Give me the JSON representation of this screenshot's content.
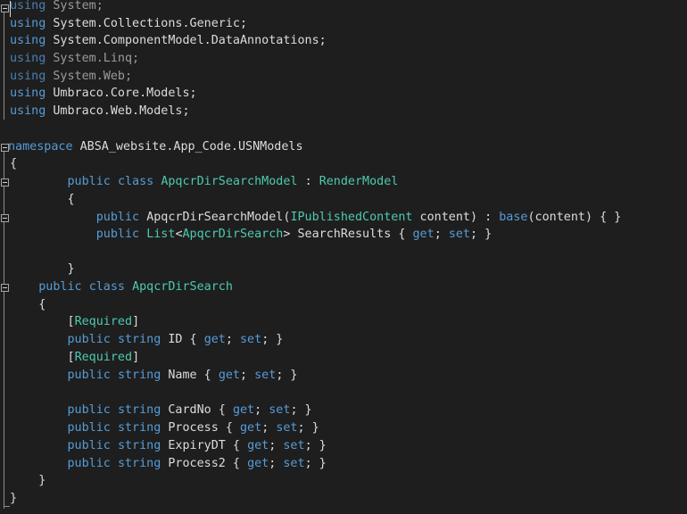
{
  "tokens": {
    "using": "using",
    "namespace": "namespace",
    "public": "public",
    "class": "class",
    "string": "string",
    "get": "get",
    "set": "set",
    "base": "base",
    "System": "System;",
    "Collections": "System.Collections.Generic;",
    "DataAnnotations": "System.ComponentModel.DataAnnotations;",
    "Linq": "System.Linq;",
    "Web": "System.Web;",
    "UmbracoCore": "Umbraco.Core.Models;",
    "UmbracoWeb": "Umbraco.Web.Models;",
    "nsName": "ABSA_website.App_Code.USNModels",
    "openBrace": "{",
    "closeBrace": "}",
    "colon": ":",
    "modelClass": "ApqcrDirSearchModel",
    "renderModel": "RenderModel",
    "ctorName": "ApqcrDirSearchModel(",
    "iPublished": "IPublishedContent",
    "ctorRest1": " content) : ",
    "ctorRest2": "(content) { }",
    "listType": "List",
    "lt": "<",
    "gt": ">",
    "searchType": "ApqcrDirSearch",
    "searchResults": " SearchResults { ",
    "accEnd": "; }",
    "semiSpace": "; ",
    "required": "Required",
    "lbr": "[",
    "rbr": "]",
    "idProp": " ID { ",
    "nameProp": " Name { ",
    "cardNoProp": " CardNo { ",
    "processProp": " Process { ",
    "expiryProp": " ExpiryDT { ",
    "process2Prop": " Process2 { "
  }
}
